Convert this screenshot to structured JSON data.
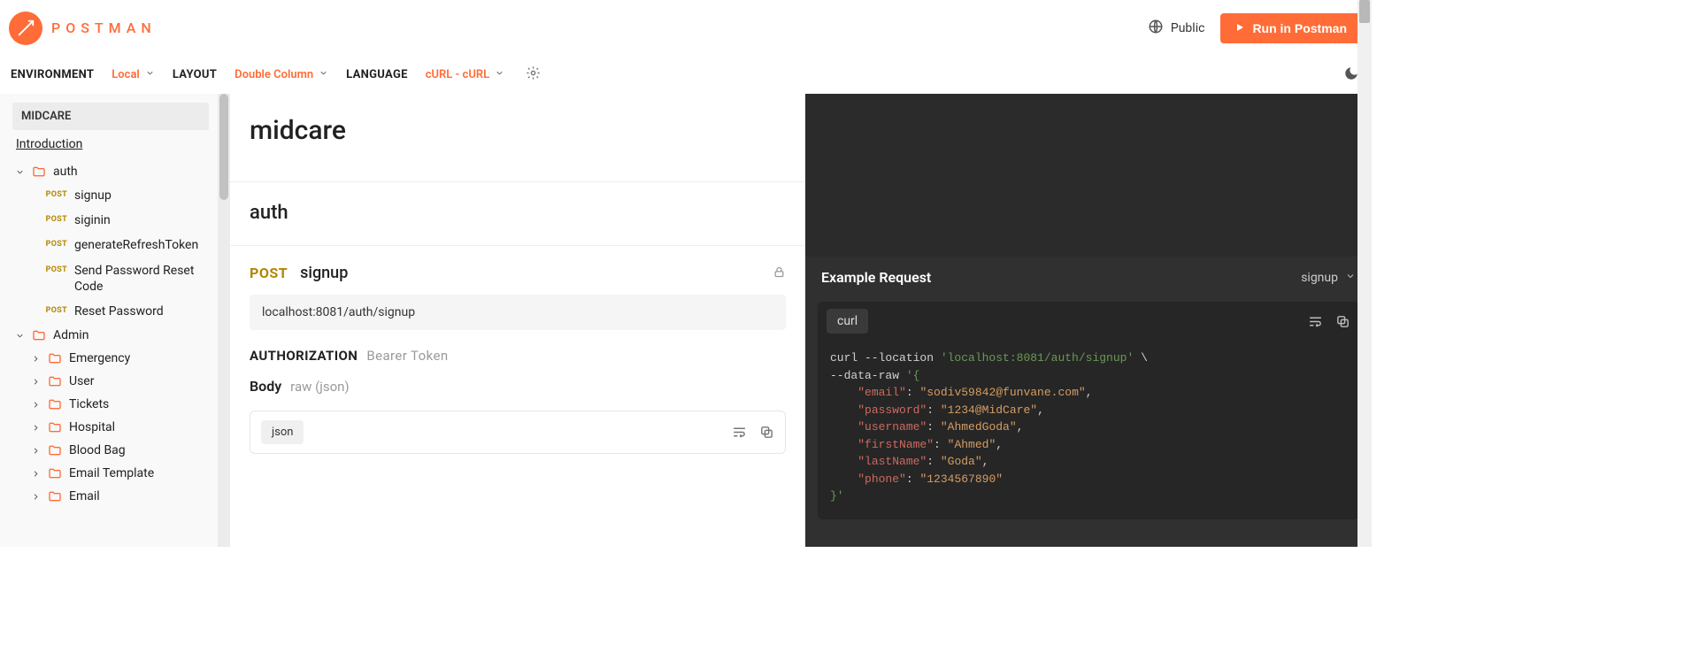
{
  "brand": {
    "name": "POSTMAN"
  },
  "header": {
    "public_label": "Public",
    "run_label": "Run in Postman"
  },
  "toolbar": {
    "env_label": "ENVIRONMENT",
    "env_value": "Local",
    "layout_label": "LAYOUT",
    "layout_value": "Double Column",
    "lang_label": "LANGUAGE",
    "lang_value": "cURL - cURL"
  },
  "sidebar": {
    "collection": "MIDCARE",
    "intro": "Introduction",
    "folders": [
      {
        "name": "auth",
        "open": true,
        "requests": [
          {
            "method": "POST",
            "name": "signup"
          },
          {
            "method": "POST",
            "name": "siginin"
          },
          {
            "method": "POST",
            "name": "generateRefreshToken"
          },
          {
            "method": "POST",
            "name": "Send Password Reset Code"
          },
          {
            "method": "POST",
            "name": "Reset Password"
          }
        ]
      },
      {
        "name": "Admin",
        "open": true,
        "children": [
          {
            "name": "Emergency"
          },
          {
            "name": "User"
          },
          {
            "name": "Tickets"
          },
          {
            "name": "Hospital"
          },
          {
            "name": "Blood Bag"
          },
          {
            "name": "Email Template"
          },
          {
            "name": "Email"
          }
        ]
      }
    ]
  },
  "doc": {
    "collection_title": "midcare",
    "section_title": "auth",
    "request": {
      "method": "POST",
      "name": "signup",
      "url": "localhost:8081/auth/signup",
      "auth_label": "AUTHORIZATION",
      "auth_type": "Bearer Token",
      "body_label": "Body",
      "body_type": "raw (json)",
      "json_chip": "json"
    }
  },
  "example": {
    "title": "Example Request",
    "selected": "signup",
    "lang": "curl",
    "code": {
      "cmd": "curl --location ",
      "url": "'localhost:8081/auth/signup'",
      "cont": " \\",
      "dataflag": "--data-raw ",
      "open": "'{",
      "lines": [
        {
          "key": "\"email\"",
          "sep": ": ",
          "val": "\"sodiv59842@funvane.com\"",
          "tail": ","
        },
        {
          "key": "\"password\"",
          "sep": ": ",
          "val": "\"1234@MidCare\"",
          "tail": ","
        },
        {
          "key": "\"username\"",
          "sep": ": ",
          "val": "\"AhmedGoda\"",
          "tail": ","
        },
        {
          "key": "\"firstName\"",
          "sep": ": ",
          "val": "\"Ahmed\"",
          "tail": ","
        },
        {
          "key": "\"lastName\"",
          "sep": ": ",
          "val": "\"Goda\"",
          "tail": ","
        },
        {
          "key": "\"phone\"",
          "sep": ": ",
          "val": "\"1234567890\"",
          "tail": ""
        }
      ],
      "close": "}'"
    }
  }
}
